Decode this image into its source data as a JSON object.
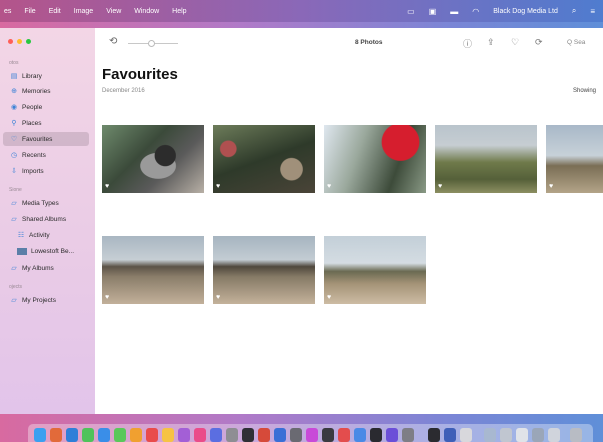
{
  "menubar": {
    "items": [
      "es",
      "File",
      "Edit",
      "Image",
      "View",
      "Window",
      "Help"
    ],
    "account": "Black Dog Media Ltd"
  },
  "toolbar": {
    "count": "8 Photos",
    "search_placeholder": "Q Sea"
  },
  "sidebar": {
    "section_photos": "otos",
    "section_shared": "Sione",
    "section_projects": "ojects",
    "items": [
      {
        "label": "Library",
        "icon": "library-icon"
      },
      {
        "label": "Memories",
        "icon": "memories-icon"
      },
      {
        "label": "People",
        "icon": "people-icon"
      },
      {
        "label": "Places",
        "icon": "places-icon"
      },
      {
        "label": "Favourites",
        "icon": "heart-icon",
        "selected": true
      },
      {
        "label": "Recents",
        "icon": "clock-icon"
      },
      {
        "label": "Imports",
        "icon": "imports-icon"
      },
      {
        "label": "Media Types",
        "icon": "folder-icon"
      },
      {
        "label": "Shared Albums",
        "icon": "folder-icon"
      },
      {
        "label": "Activity",
        "icon": "activity-icon"
      },
      {
        "label": "Lowestoft Be...",
        "icon": "album-thumb"
      },
      {
        "label": "My Albums",
        "icon": "folder-icon"
      },
      {
        "label": "My Projects",
        "icon": "folder-icon"
      }
    ]
  },
  "main": {
    "title": "Favourites",
    "date": "December 2016",
    "showing": "Showing"
  },
  "photos": [
    {
      "subject": "cat"
    },
    {
      "subject": "christmas-tree-baubles"
    },
    {
      "subject": "red-bauble"
    },
    {
      "subject": "mossy-groyne"
    },
    {
      "subject": "beach-posts"
    },
    {
      "subject": "pier"
    },
    {
      "subject": "pier"
    },
    {
      "subject": "beach-rocks"
    }
  ],
  "colors": {
    "accent": "#3b82d6",
    "selection": "#d9b8cf"
  }
}
